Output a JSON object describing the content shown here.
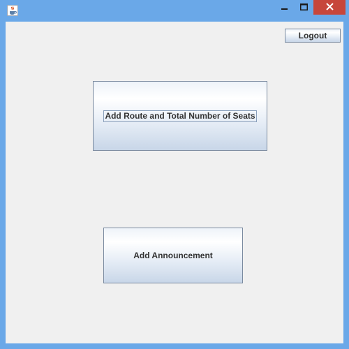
{
  "window": {
    "app_icon": "java-cup-icon",
    "controls": {
      "minimize_icon": "minimize-icon",
      "maximize_icon": "maximize-icon",
      "close_icon": "close-icon"
    }
  },
  "buttons": {
    "logout_label": "Logout",
    "add_route_label": "Add Route and Total Number of Seats",
    "add_announcement_label": "Add Announcement"
  },
  "colors": {
    "title_bar": "#6aa8e8",
    "close_button": "#c7463b",
    "client_background": "#f0f0f0"
  }
}
